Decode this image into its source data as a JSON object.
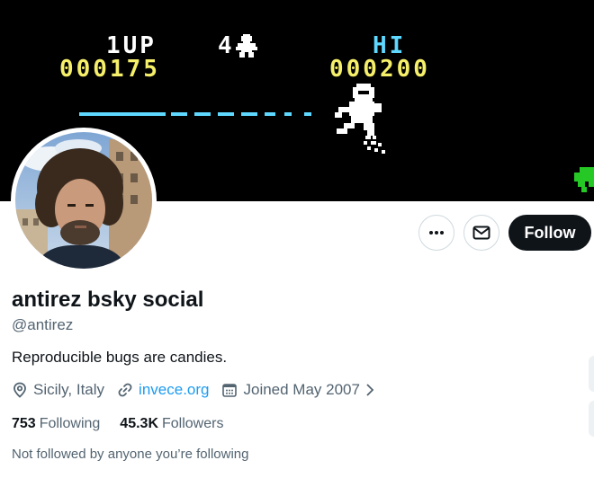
{
  "banner": {
    "player_label": "1UP",
    "lives": "4",
    "hi_label": "HI",
    "player_score": "000175",
    "hi_score": "000200"
  },
  "actions": {
    "more_icon": "ellipsis-icon",
    "message_icon": "envelope-icon",
    "follow_label": "Follow"
  },
  "profile": {
    "display_name": "antirez bsky social",
    "handle": "@antirez",
    "bio": "Reproducible bugs are candies.",
    "location": "Sicily, Italy",
    "website": "invece.org",
    "joined": "Joined May 2007",
    "following_count": "753",
    "following_label": "Following",
    "followers_count": "45.3K",
    "followers_label": "Followers",
    "mutuals_note": "Not followed by anyone you’re following"
  },
  "colors": {
    "banner_bg": "#000000",
    "score_yellow": "#f5ef6a",
    "hi_cyan": "#5fd8ff",
    "link_blue": "#1d9bf0",
    "text_primary": "#0f1419",
    "text_secondary": "#536471"
  }
}
